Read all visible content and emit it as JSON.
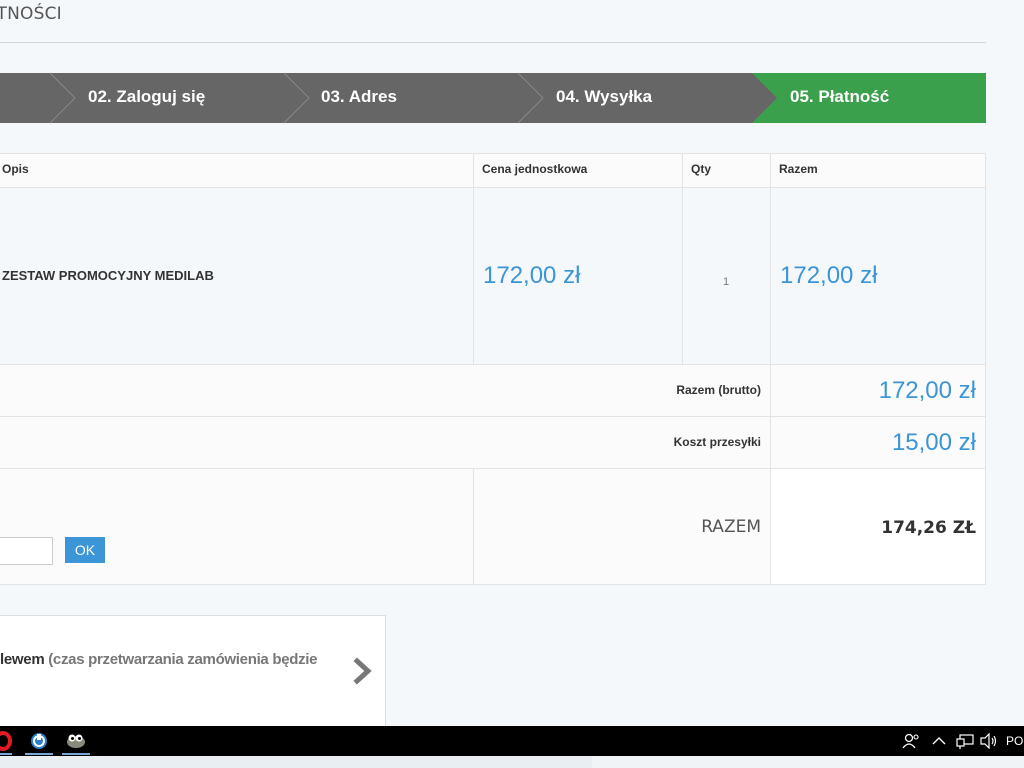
{
  "page": {
    "title": "ATNOŚCI"
  },
  "steps": [
    {
      "label": ""
    },
    {
      "label": "02. Zaloguj się"
    },
    {
      "label": "03. Adres"
    },
    {
      "label": "04. Wysyłka"
    },
    {
      "label": "05. Płatność"
    }
  ],
  "colors": {
    "accent": "#3b95d6",
    "step_active": "#3aa04b",
    "step_inactive": "#666666"
  },
  "cart": {
    "headers": {
      "description": "Opis",
      "unit_price": "Cena jednostkowa",
      "qty": "Qty",
      "total": "Razem"
    },
    "items": [
      {
        "name": "ZESTAW PROMOCYJNY MEDILAB",
        "unit_price": "172,00 zł",
        "qty": "1",
        "total": "172,00 zł"
      }
    ],
    "summary": {
      "gross_label": "Razem (brutto)",
      "gross_value": "172,00 zł",
      "shipping_label": "Koszt przesyłki",
      "shipping_value": "15,00 zł",
      "total_label": "RAZEM",
      "total_value": "174,26 ZŁ"
    },
    "voucher": {
      "value": "",
      "button_label": "OK"
    }
  },
  "payment": {
    "option_strong": "lewem",
    "option_light": " (czas przetwarzania zamówienia będzie",
    "arrow_icon": "chevron-right-icon"
  },
  "taskbar": {
    "apps": [
      "opera-icon",
      "browser-icon",
      "gimp-icon"
    ],
    "tray_icons": [
      "people-icon",
      "chevron-up-icon",
      "network-icon",
      "volume-icon"
    ],
    "language": "PO"
  }
}
